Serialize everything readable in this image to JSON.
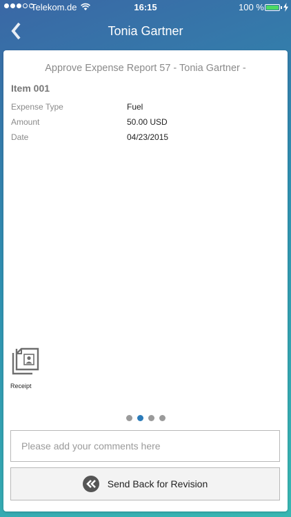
{
  "status_bar": {
    "carrier": "Telekom.de",
    "time": "16:15",
    "battery": "100 %"
  },
  "nav": {
    "title": "Tonia Gartner"
  },
  "report": {
    "title": "Approve Expense Report 57 - Tonia Gartner -",
    "item_title": "Item 001",
    "details": [
      {
        "label": "Expense Type",
        "value": "Fuel"
      },
      {
        "label": "Amount",
        "value": "50.00 USD"
      },
      {
        "label": "Date",
        "value": "04/23/2015"
      }
    ]
  },
  "attachment": {
    "label": "Receipt",
    "icon": "receipt-icon"
  },
  "pagination": {
    "total_pages": 4,
    "current_page": 2
  },
  "comment": {
    "placeholder": "Please add your comments here",
    "value": ""
  },
  "action": {
    "label": "Send Back for Revision",
    "icon": "double-chevron-left-icon"
  },
  "colors": {
    "accent": "#2b7bb9",
    "battery_green": "#4cd964"
  }
}
